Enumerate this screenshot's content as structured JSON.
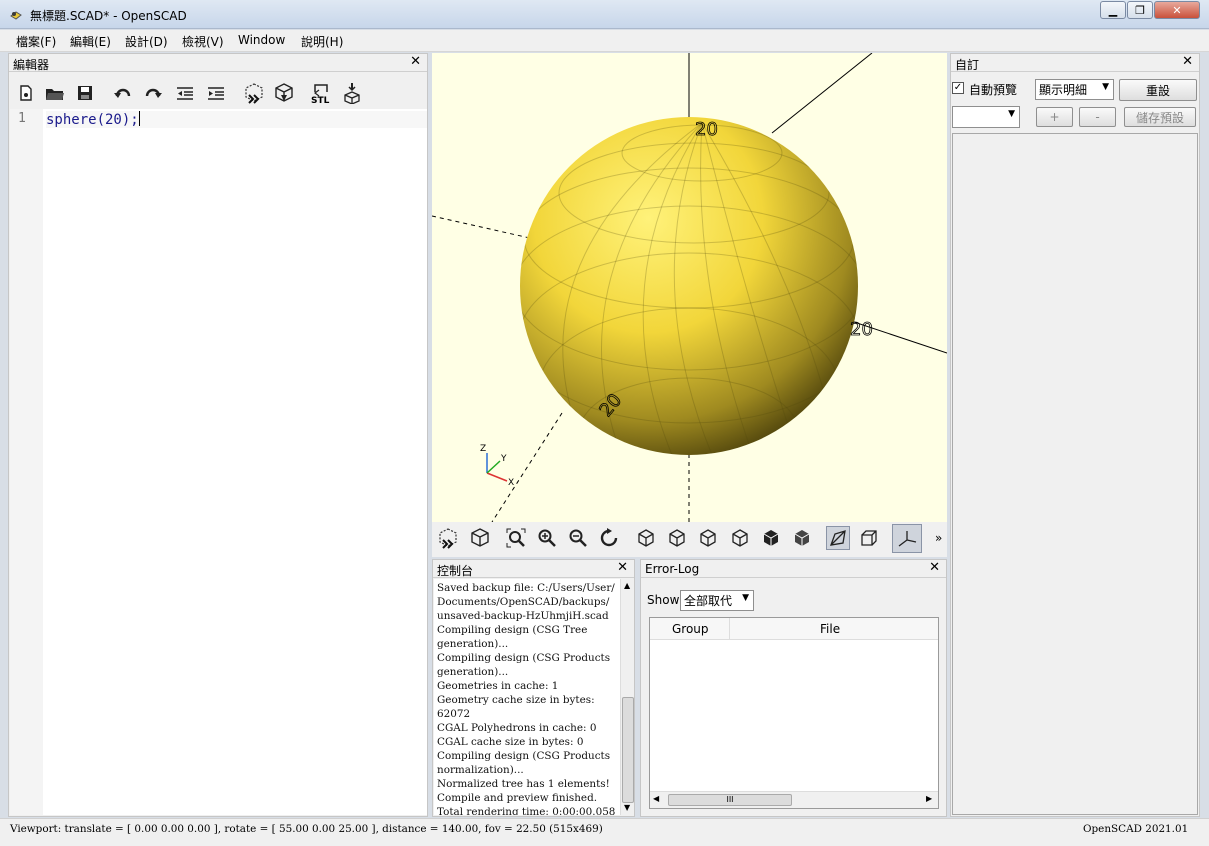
{
  "window": {
    "title": "無標題.SCAD* - OpenSCAD"
  },
  "menu": [
    "檔案(F)",
    "編輯(E)",
    "設計(D)",
    "檢視(V)",
    "Window",
    "說明(H)"
  ],
  "editor": {
    "title": "編輯器",
    "line_number": "1",
    "code": "sphere(20);"
  },
  "viewport": {
    "axis_labels": {
      "x": "X",
      "y": "Y",
      "z": "Z"
    },
    "scale_labels": [
      "20",
      "20",
      "20"
    ],
    "colors": {
      "background": "#ffffe5",
      "model": "#f2d63a"
    }
  },
  "console": {
    "title": "控制台",
    "lines": [
      "Saved backup file: C:/Users/User/",
      "Documents/OpenSCAD/backups/",
      "unsaved-backup-HzUhmjiH.scad",
      "Compiling design (CSG Tree",
      "generation)...",
      "Compiling design (CSG Products",
      "generation)...",
      "Geometries in cache: 1",
      "Geometry cache size in bytes: 62072",
      "CGAL Polyhedrons in cache: 0",
      "CGAL cache size in bytes: 0",
      "Compiling design (CSG Products",
      "normalization)...",
      "Normalized tree has 1 elements!",
      "Compile and preview finished.",
      "Total rendering time: 0:00:00.058"
    ]
  },
  "errorlog": {
    "title": "Error-Log",
    "show_label": "Show",
    "filter_value": "全部取代",
    "columns": [
      "Group",
      "File"
    ],
    "scroll_mid": "III"
  },
  "customizer": {
    "title": "自訂",
    "auto_preview_label": "自動預覽",
    "auto_preview_checked": true,
    "detail_value": "顯示明細",
    "reset_label": "重設",
    "preset_value": "",
    "plus_label": "+",
    "minus_label": "-",
    "save_preset_label": "儲存預設"
  },
  "status": {
    "viewport_info": "Viewport: translate = [ 0.00 0.00 0.00 ], rotate = [ 55.00 0.00 25.00 ], distance = 140.00, fov = 22.50 (515x469)",
    "version": "OpenSCAD 2021.01"
  },
  "toolbar_more": "»"
}
